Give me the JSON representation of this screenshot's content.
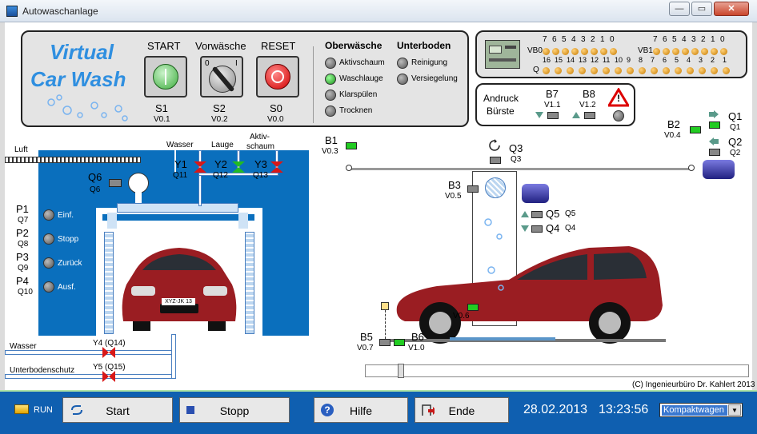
{
  "window": {
    "title": "Autowaschanlage",
    "minimize": "—",
    "maximize": "▭",
    "close": "✕"
  },
  "control_panel": {
    "brand_line1": "Virtual",
    "brand_line2": "Car Wash",
    "start_label": "START",
    "pre_wash_label": "Vorwäsche",
    "reset_label": "RESET",
    "s1_label": "S1",
    "s1_addr": "V0.1",
    "s2_label": "S2",
    "s2_addr": "V0.2",
    "s0_label": "S0",
    "s0_addr": "V0.0",
    "switch_off": "0",
    "switch_on": "I",
    "top_wash_header": "Oberwäsche",
    "underbody_header": "Unterboden",
    "top_wash_options": [
      "Aktivschaum",
      "Waschlauge",
      "Klarspülen",
      "Trocknen"
    ],
    "underbody_options": [
      "Reinigung",
      "Versiegelung"
    ]
  },
  "plc_panel": {
    "vb0_label": "VB0",
    "vb1_label": "VB1",
    "q_label": "Q",
    "vb0_bits": [
      "7",
      "6",
      "5",
      "4",
      "3",
      "2",
      "1",
      "0"
    ],
    "vb1_bits": [
      "7",
      "6",
      "5",
      "4",
      "3",
      "2",
      "1",
      "0"
    ],
    "q_bits": [
      "16",
      "15",
      "14",
      "13",
      "12",
      "11",
      "10",
      "9",
      "8",
      "7",
      "6",
      "5",
      "4",
      "3",
      "2",
      "1"
    ]
  },
  "brush_panel": {
    "title_line1": "Andruck",
    "title_line2": "Bürste",
    "b7_label": "B7",
    "b7_addr": "V1.1",
    "b8_label": "B8",
    "b8_addr": "V1.2",
    "warning": "!"
  },
  "left_machine": {
    "air_label": "Luft",
    "water_label": "Wasser",
    "lye_label": "Lauge",
    "foam_label1": "Aktiv-",
    "foam_label2": "schaum",
    "y1": "Y1",
    "y1q": "Q11",
    "y2": "Y2",
    "y2q": "Q12",
    "y3": "Y3",
    "y3q": "Q13",
    "q6": "Q6",
    "q6b": "Q6",
    "p1": "P1",
    "p1q": "Q7",
    "p2": "P2",
    "p2q": "Q8",
    "p3": "P3",
    "p3q": "Q9",
    "p4": "P4",
    "p4q": "Q10",
    "lamp_labels": [
      "Einf.",
      "Stopp",
      "Zurück",
      "Ausf."
    ],
    "water_in_label": "Wasser",
    "underbody_in_label": "Unterbodenschutz",
    "y4": "Y4 (Q14)",
    "y5": "Y5 (Q15)",
    "plate": "XYZ-JK 13"
  },
  "right_machine": {
    "b1": "B1",
    "b1addr": "V0.3",
    "q3": "Q3",
    "q3b": "Q3",
    "b2": "B2",
    "b2addr": "V0.4",
    "q1": "Q1",
    "q1b": "Q1",
    "q2": "Q2",
    "q2b": "Q2",
    "b3": "B3",
    "b3addr": "V0.5",
    "q5": "Q5",
    "q5b": "Q5",
    "q4": "Q4",
    "q4b": "Q4",
    "b4addr": "V0.6",
    "b5": "B5",
    "b5addr": "V0.7",
    "b6": "B6",
    "b6addr": "V1.0",
    "copyright": "(C) Ingenieurbüro Dr. Kahlert 2013"
  },
  "taskbar": {
    "run_label": "RUN",
    "start_button": "Start",
    "stop_button": "Stopp",
    "help_button": "Hilfe",
    "end_button": "Ende",
    "date": "28.02.2013",
    "time": "13:23:56",
    "car_select": "Kompaktwagen"
  },
  "colors": {
    "machine_blue": "#0a6fbd",
    "brand_blue": "#2f8fe0",
    "taskbar_blue": "#0f5fb0",
    "lamp_green": "#22cc22",
    "car_red": "#9a1d22"
  }
}
